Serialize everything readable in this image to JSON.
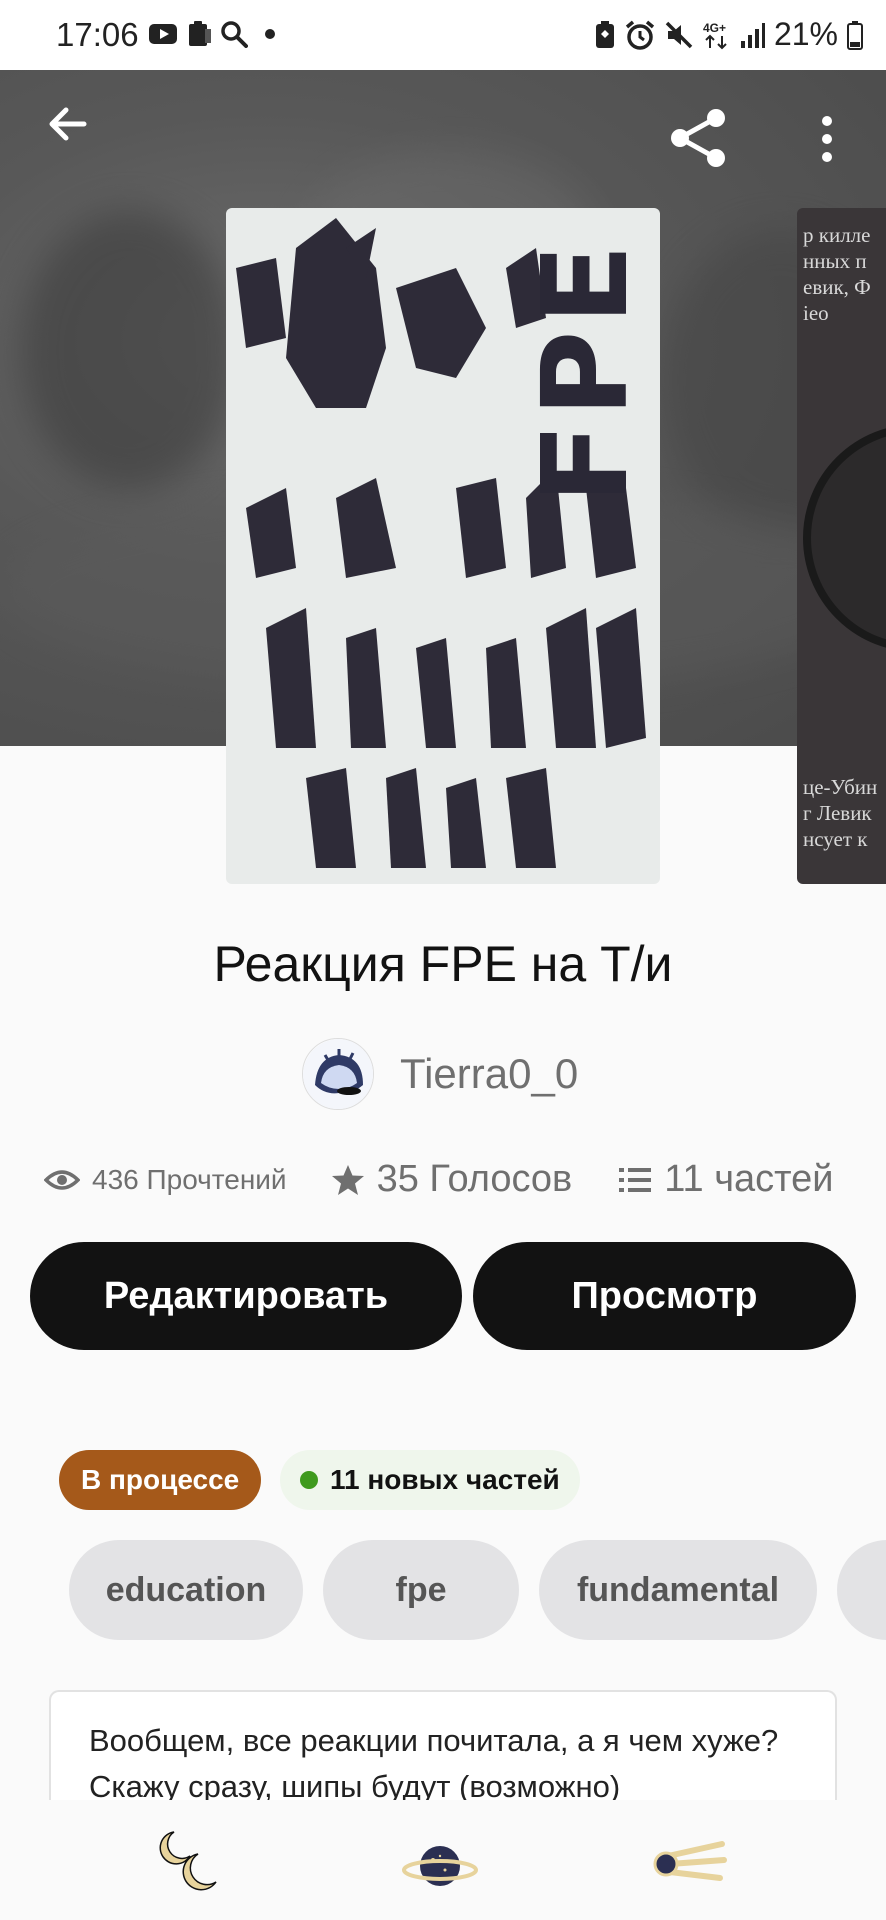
{
  "status_bar": {
    "time": "17:06",
    "battery": "21%",
    "network": "4G+"
  },
  "header": {
    "back_icon": "arrow-left-icon",
    "share_icon": "share-icon",
    "more_icon": "more-vertical-icon"
  },
  "cover": {
    "title_text": "FPE",
    "side_cover_lines_top": [
      "р килле",
      "нных п",
      "евик, Ф",
      "ieo"
    ],
    "side_cover_lines_bottom": [
      "це-Убин",
      "г Левик",
      "нсует к"
    ]
  },
  "story": {
    "title": "Реакция FPE на Т/и",
    "author": "Tierra0_0"
  },
  "stats": {
    "reads": "436 Прочтений",
    "votes": "35 Голосов",
    "parts": "11 частей"
  },
  "actions": {
    "edit": "Редактировать",
    "view": "Просмотр"
  },
  "badges": {
    "status": "В процессе",
    "new_parts": "11 новых частей"
  },
  "tags": [
    "education",
    "fpe",
    "fundamental"
  ],
  "description": "Вообщем, все реакции почитала, а я чем хуже? Скажу сразу, шипы будут (возможно)",
  "bottom_nav": {
    "items": [
      "moons-icon",
      "planet-icon",
      "comet-icon"
    ]
  },
  "colors": {
    "status_badge": "#a5591a",
    "button": "#121212",
    "new_parts_dot": "#3f9a1e"
  }
}
